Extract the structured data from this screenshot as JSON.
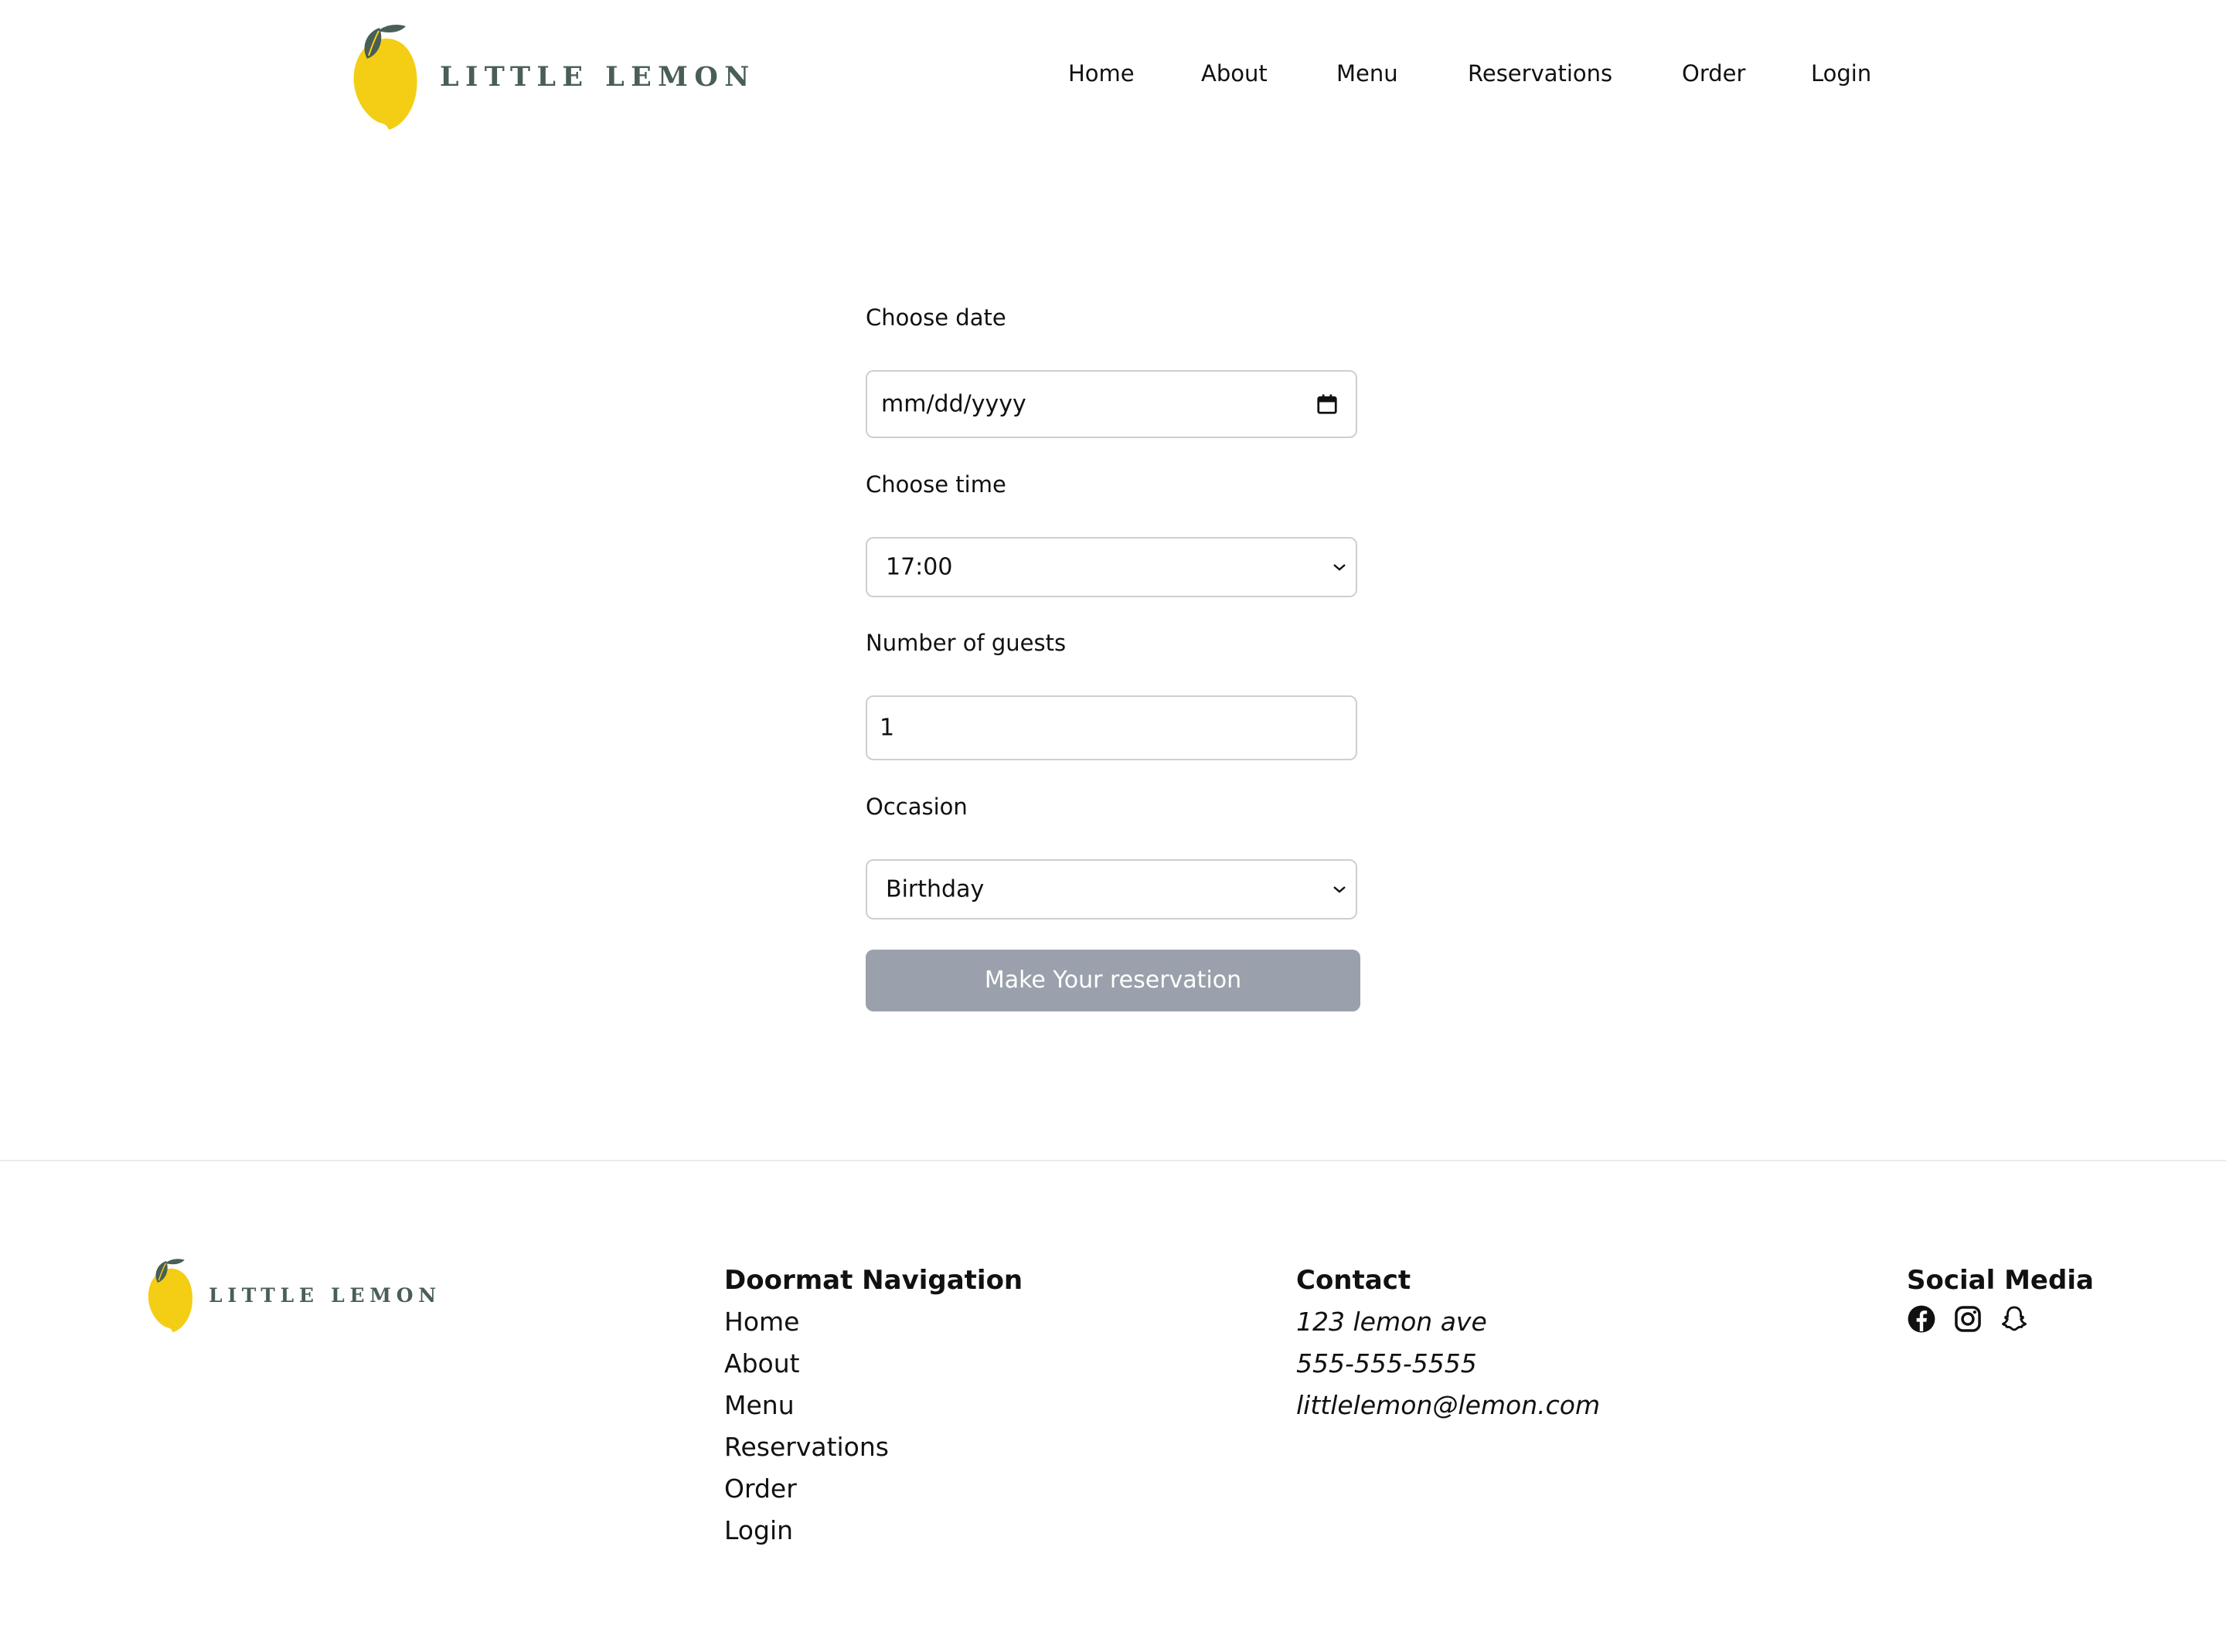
{
  "brand": {
    "name": "LITTLE LEMON",
    "logo_color": "#f4ce14",
    "leaf_color": "#495e57"
  },
  "nav": {
    "items": [
      {
        "label": "Home"
      },
      {
        "label": "About"
      },
      {
        "label": "Menu"
      },
      {
        "label": "Reservations"
      },
      {
        "label": "Order"
      },
      {
        "label": "Login"
      }
    ]
  },
  "form": {
    "date": {
      "label": "Choose date",
      "placeholder": "mm/dd/yyyy",
      "icon": "calendar-icon"
    },
    "time": {
      "label": "Choose time",
      "value": "17:00",
      "icon": "chevron-down-icon"
    },
    "guests": {
      "label": "Number of guests",
      "value": "1"
    },
    "occasion": {
      "label": "Occasion",
      "value": "Birthday",
      "icon": "chevron-down-icon"
    },
    "submit_label": "Make Your reservation",
    "submit_color": "#9aa1ac"
  },
  "footer": {
    "doormat": {
      "title": "Doormat Navigation",
      "items": [
        "Home",
        "About",
        "Menu",
        "Reservations",
        "Order",
        "Login"
      ]
    },
    "contact": {
      "title": "Contact",
      "address": "123 lemon ave",
      "phone": "555-555-5555",
      "email": "littlelemon@lemon.com"
    },
    "social": {
      "title": "Social Media",
      "icons": [
        "facebook-icon",
        "instagram-icon",
        "snapchat-icon"
      ]
    }
  }
}
